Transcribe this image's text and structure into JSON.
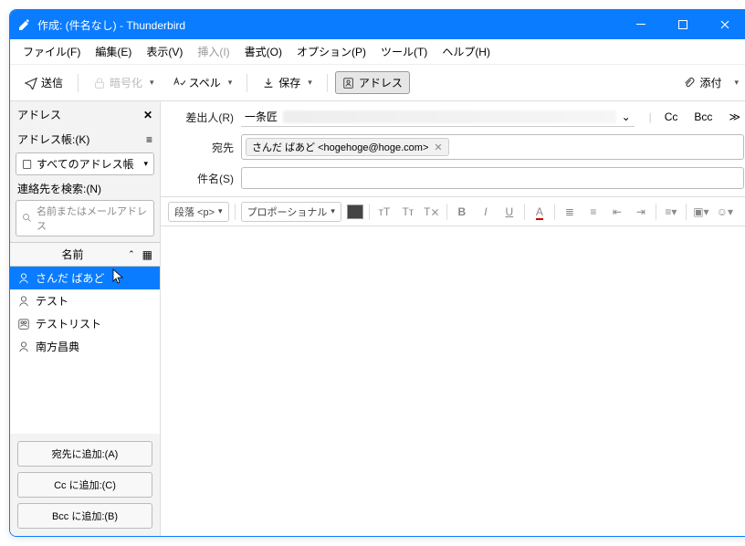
{
  "title": "作成: (件名なし) - Thunderbird",
  "menu": [
    "ファイル(F)",
    "編集(E)",
    "表示(V)",
    "挿入(I)",
    "書式(O)",
    "オプション(P)",
    "ツール(T)",
    "ヘルプ(H)"
  ],
  "toolbar": {
    "send": "送信",
    "encrypt": "暗号化",
    "spell": "スペル",
    "save": "保存",
    "address": "アドレス",
    "attach": "添付"
  },
  "sidebar": {
    "title": "アドレス",
    "book_label": "アドレス帳:(K)",
    "book_value": "すべてのアドレス帳",
    "search_label": "連絡先を検索:(N)",
    "search_placeholder": "名前またはメールアドレス",
    "col_name": "名前",
    "contacts": [
      {
        "name": "さんだ ばあど",
        "type": "person",
        "selected": true
      },
      {
        "name": "テスト",
        "type": "person",
        "selected": false
      },
      {
        "name": "テストリスト",
        "type": "list",
        "selected": false
      },
      {
        "name": "南方昌典",
        "type": "person",
        "selected": false
      }
    ],
    "addTo": "宛先に追加:(A)",
    "addCc": "Cc に追加:(C)",
    "addBcc": "Bcc に追加:(B)"
  },
  "header": {
    "from_label": "差出人(R)",
    "from_name": "一条匠",
    "to_label": "宛先",
    "to_chip": "さんだ ばあど <hogehoge@hoge.com>",
    "subject_label": "件名(S)",
    "cc": "Cc",
    "bcc": "Bcc"
  },
  "format": {
    "para": "段落 <p>",
    "font": "プロポーショナル"
  }
}
